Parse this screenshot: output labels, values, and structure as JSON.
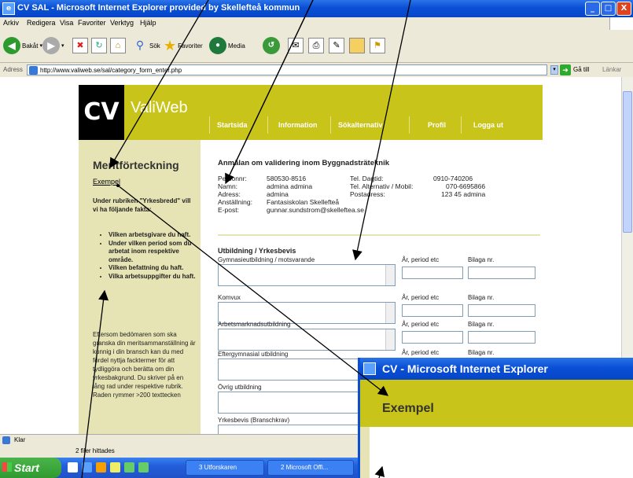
{
  "window": {
    "title": "CV SAL - Microsoft Internet Explorer provided by Skellefteå kommun",
    "controls": {
      "minimize": "_",
      "maximize": "□",
      "close": "X"
    }
  },
  "menu": [
    "Arkiv",
    "Redigera",
    "Visa",
    "Favoriter",
    "Verktyg",
    "Hjälp"
  ],
  "toolbar": {
    "back": "Bakåt",
    "search": "Sök",
    "favorites": "Favoriter",
    "media": "Media"
  },
  "address": {
    "label": "Adress",
    "url": "http://www.valiweb.se/sal/category_form_enter.php",
    "go": "Gå till",
    "links": "Länkar"
  },
  "site": {
    "logo": "CV",
    "brand": "ValiWeb",
    "nav": [
      "Startsida",
      "Information",
      "Sökalternativ",
      "Profil",
      "Logga ut"
    ]
  },
  "sidebar": {
    "heading": "Meritförteckning",
    "link": "Exempel",
    "intro": "Under rubriken \"Yrkesbredd\" vill vi ha följande fakta:",
    "items": [
      "Vilken arbetsgivare du haft.",
      "Under vilken period som du arbetat inom respektive område.",
      "Vilken befattning du haft.",
      "Vilka arbetsuppgifter du haft."
    ],
    "paragraph": "Eftersom bedömaren som ska granska din meritsammanställning är kunnig i din bransch kan du med fördel nyttja facktermer för att tydliggöra och berätta om din yrkesbakgrund. Du skriver på en lång rad under respektive rubrik. Raden rymmer >200 texttecken"
  },
  "main": {
    "heading": "Anmälan om validering inom Byggnadsträteknik",
    "person": {
      "personnr_label": "Personnr:",
      "personnr": "580530-8516",
      "namn_label": "Namn:",
      "namn": "admina admina",
      "adress_label": "Adress:",
      "adress": "admina",
      "anstallning_label": "Anställning:",
      "anstallning": "Fantasiskolan Skellefteå",
      "epost_label": "E-post:",
      "epost": "gunnar.sundstrom@skelleftea.se",
      "tel_dag_label": "Tel. Dagtid:",
      "tel_dag": "0910-740206",
      "tel_alt_label": "Tel. Alternativ / Mobil:",
      "tel_alt": "070-6695866",
      "postadress_label": "Postadress:",
      "postadress": "123 45 admina"
    },
    "section": "Utbildning / Yrkesbevis",
    "col_period": "År, period etc",
    "col_bilaga": "Bilaga nr.",
    "fields": [
      "Gymnasieutbildning / motsvarande",
      "Komvux",
      "Arbetsmarknadsutbildning",
      "Eftergymnasial utbildning",
      "Övrig utbildning",
      "Yrkesbevis (Branschkrav)"
    ]
  },
  "status": {
    "ready": "Klar",
    "found": "2 filer hittades"
  },
  "taskbar": {
    "start": "Start",
    "items": [
      "3 Utforskaren",
      "2 Microsoft Offi..."
    ]
  },
  "popup": {
    "title": "CV - Microsoft Internet Explorer",
    "heading": "Exempel"
  },
  "colors": {
    "accent": "#c9c419",
    "sidebar": "#e6e4b4",
    "xp_blue": "#0a4fd6"
  }
}
